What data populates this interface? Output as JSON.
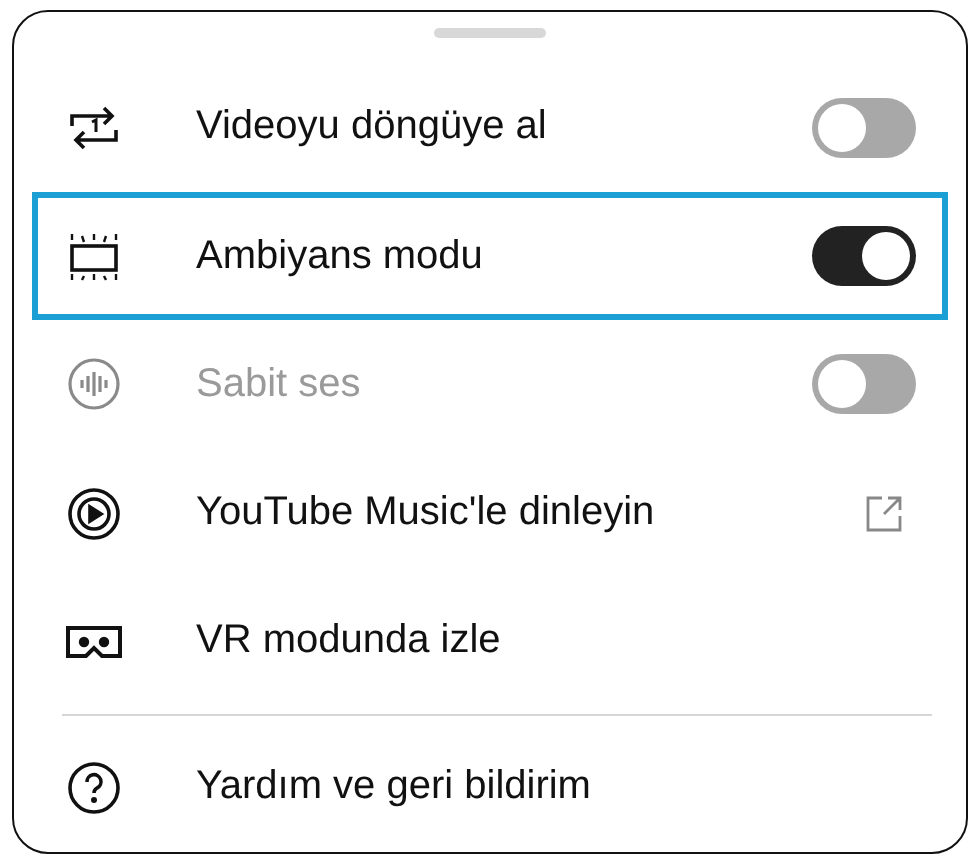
{
  "menu": {
    "sections": [
      {
        "items": [
          {
            "label": "Videoyu döngüye al",
            "kind": "toggle",
            "on": false,
            "disabled": false,
            "highlighted": false
          },
          {
            "label": "Ambiyans modu",
            "kind": "toggle",
            "on": true,
            "disabled": false,
            "highlighted": true
          },
          {
            "label": "Sabit ses",
            "kind": "toggle",
            "on": false,
            "disabled": true,
            "highlighted": false
          },
          {
            "label": "YouTube Music'le dinleyin",
            "kind": "external",
            "disabled": false,
            "highlighted": false
          },
          {
            "label": "VR modunda izle",
            "kind": "plain",
            "disabled": false,
            "highlighted": false
          }
        ]
      },
      {
        "items": [
          {
            "label": "Yardım ve geri bildirim",
            "kind": "plain",
            "disabled": false,
            "highlighted": false
          }
        ]
      }
    ]
  }
}
